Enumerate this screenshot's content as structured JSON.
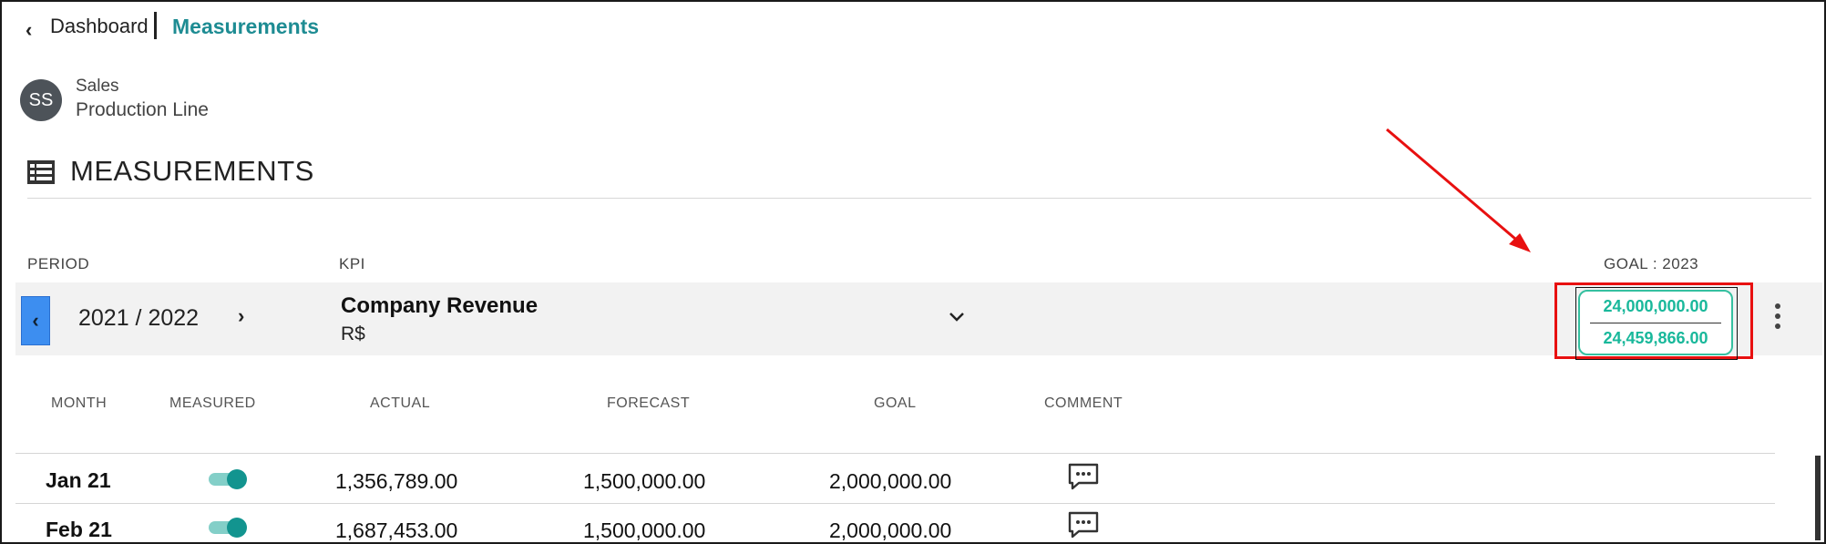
{
  "breadcrumb": {
    "back_label": "Dashboard",
    "current": "Measurements"
  },
  "unit": {
    "avatar_initials": "SS",
    "line1": "Sales",
    "line2": "Production Line"
  },
  "section": {
    "title": "MEASUREMENTS",
    "icon": "list-icon"
  },
  "header": {
    "period_label": "PERIOD",
    "kpi_label": "KPI",
    "goal_label": "GOAL : 2023"
  },
  "period": {
    "value": "2021 / 2022"
  },
  "kpi": {
    "name": "Company Revenue",
    "unit": "R$"
  },
  "goal": {
    "value1": "24,000,000.00",
    "value2": "24,459,866.00"
  },
  "table": {
    "columns": {
      "month": "MONTH",
      "measured": "MEASURED",
      "actual": "ACTUAL",
      "forecast": "FORECAST",
      "goal": "GOAL",
      "comment": "COMMENT"
    },
    "rows": [
      {
        "month": "Jan 21",
        "measured": true,
        "actual": "1,356,789.00",
        "forecast": "1,500,000.00",
        "goal": "2,000,000.00"
      },
      {
        "month": "Feb 21",
        "measured": true,
        "actual": "1,687,453.00",
        "forecast": "1,500,000.00",
        "goal": "2,000,000.00"
      }
    ]
  },
  "colors": {
    "accent_teal": "#1e8c93",
    "goal_text": "#19b89b",
    "highlight_red": "#e81010",
    "prev_button": "#3d8ef0",
    "toggle_on": "#12948f"
  }
}
